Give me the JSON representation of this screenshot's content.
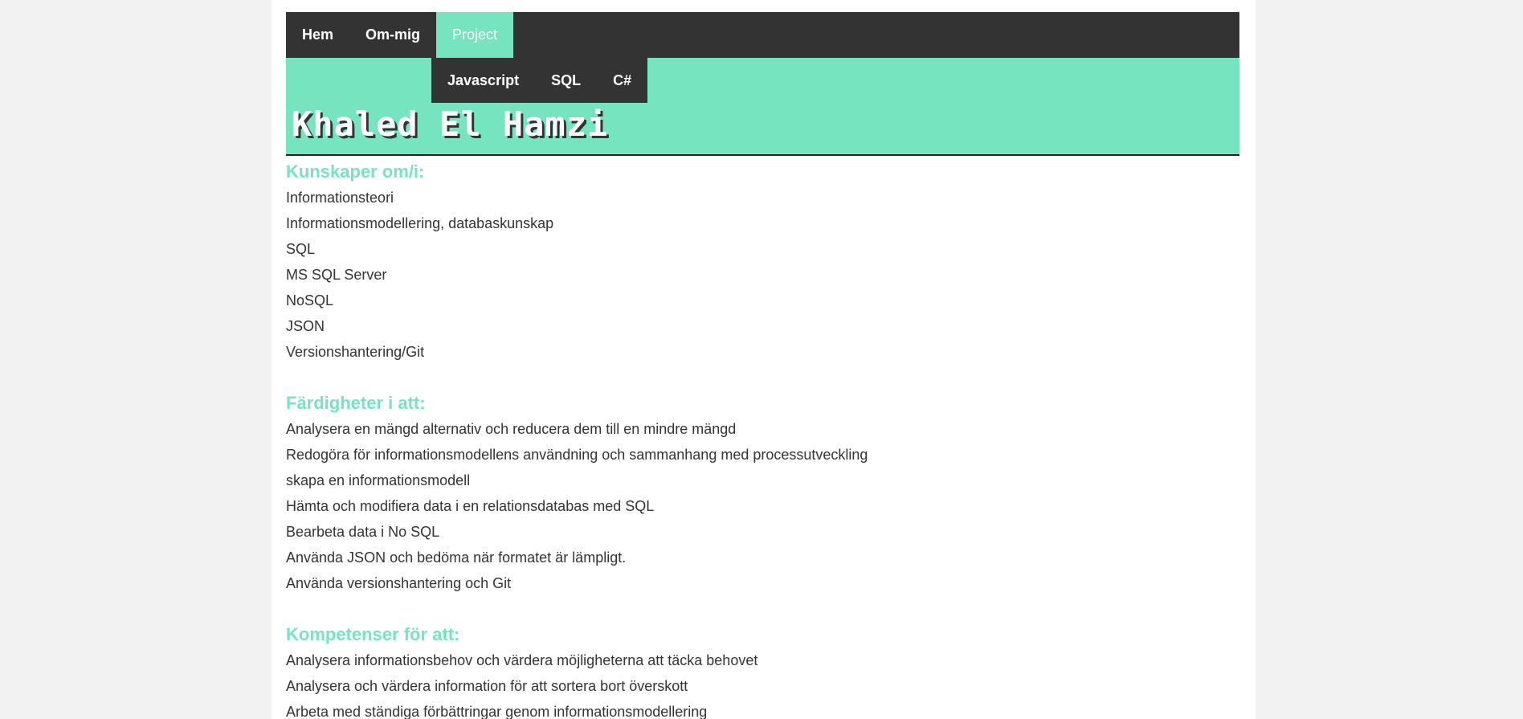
{
  "nav": {
    "items": [
      {
        "label": "Hem"
      },
      {
        "label": "Om-mig"
      },
      {
        "label": "Project"
      }
    ],
    "submenu": [
      {
        "label": "Javascript"
      },
      {
        "label": "SQL"
      },
      {
        "label": "C#"
      }
    ]
  },
  "header": {
    "title": "Khaled El Hamzi"
  },
  "sections": [
    {
      "heading": "Kunskaper om/i:",
      "items": [
        "Informationsteori",
        "Informationsmodellering, databaskunskap",
        "SQL",
        "MS SQL Server",
        "NoSQL",
        "JSON",
        "Versionshantering/Git"
      ]
    },
    {
      "heading": "Färdigheter i att:",
      "items": [
        "Analysera en mängd alternativ och reducera dem till en mindre mängd",
        "Redogöra för informationsmodellens användning och sammanhang med processutveckling",
        "skapa en informationsmodell",
        "Hämta och modifiera data i en relationsdatabas med SQL",
        "Bearbeta data i No SQL",
        "Använda JSON och bedöma när formatet är lämpligt.",
        "Använda versionshantering och Git"
      ]
    },
    {
      "heading": "Kompetenser för att:",
      "items": [
        "Analysera informationsbehov och värdera möjligheterna att täcka behovet",
        "Analysera och värdera information för att sortera bort överskott",
        "Arbeta med ständiga förbättringar genom informationsmodellering"
      ]
    }
  ],
  "colors": {
    "accent": "#76e5bf",
    "nav_bg": "#333333",
    "text": "#333333",
    "page_bg": "#f2f2f2"
  }
}
